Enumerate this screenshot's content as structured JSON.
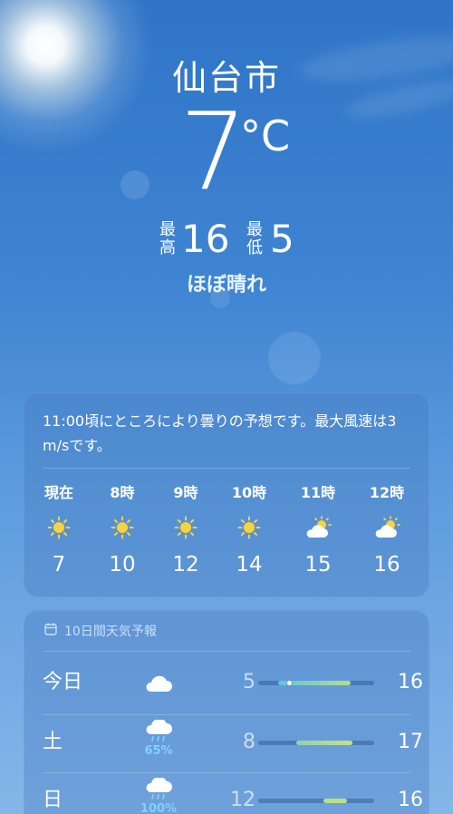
{
  "location": {
    "city": "仙台市"
  },
  "current": {
    "temperature": "7",
    "unit": "°C",
    "high_label": "最高",
    "high": "16",
    "low_label": "最低",
    "low": "5",
    "condition": "ほぼ晴れ"
  },
  "hourly": {
    "summary": "11:00頃にところにより曇りの予想です。最大風速は3 m/sです。",
    "hours": [
      {
        "time": "現在",
        "icon": "sun-icon",
        "temp": "7"
      },
      {
        "time": "8時",
        "icon": "sun-icon",
        "temp": "10"
      },
      {
        "time": "9時",
        "icon": "sun-icon",
        "temp": "12"
      },
      {
        "time": "10時",
        "icon": "sun-icon",
        "temp": "14"
      },
      {
        "time": "11時",
        "icon": "partly-cloudy-icon",
        "temp": "15"
      },
      {
        "time": "12時",
        "icon": "partly-cloudy-icon",
        "temp": "16"
      }
    ]
  },
  "daily": {
    "header": "10日間天気予報",
    "days": [
      {
        "day": "今日",
        "icon": "cloud-icon",
        "precip": "",
        "low": "5",
        "high": "16"
      },
      {
        "day": "土",
        "icon": "rain-icon",
        "precip": "65%",
        "low": "8",
        "high": "17"
      },
      {
        "day": "日",
        "icon": "rain-icon",
        "precip": "100%",
        "low": "12",
        "high": "16"
      }
    ]
  },
  "colors": {
    "sun": "#f9d33a",
    "bar_fill_today": "#6fd0c8",
    "bar_fill_warm": "#b9df8a",
    "precip": "#7fd2ff"
  }
}
